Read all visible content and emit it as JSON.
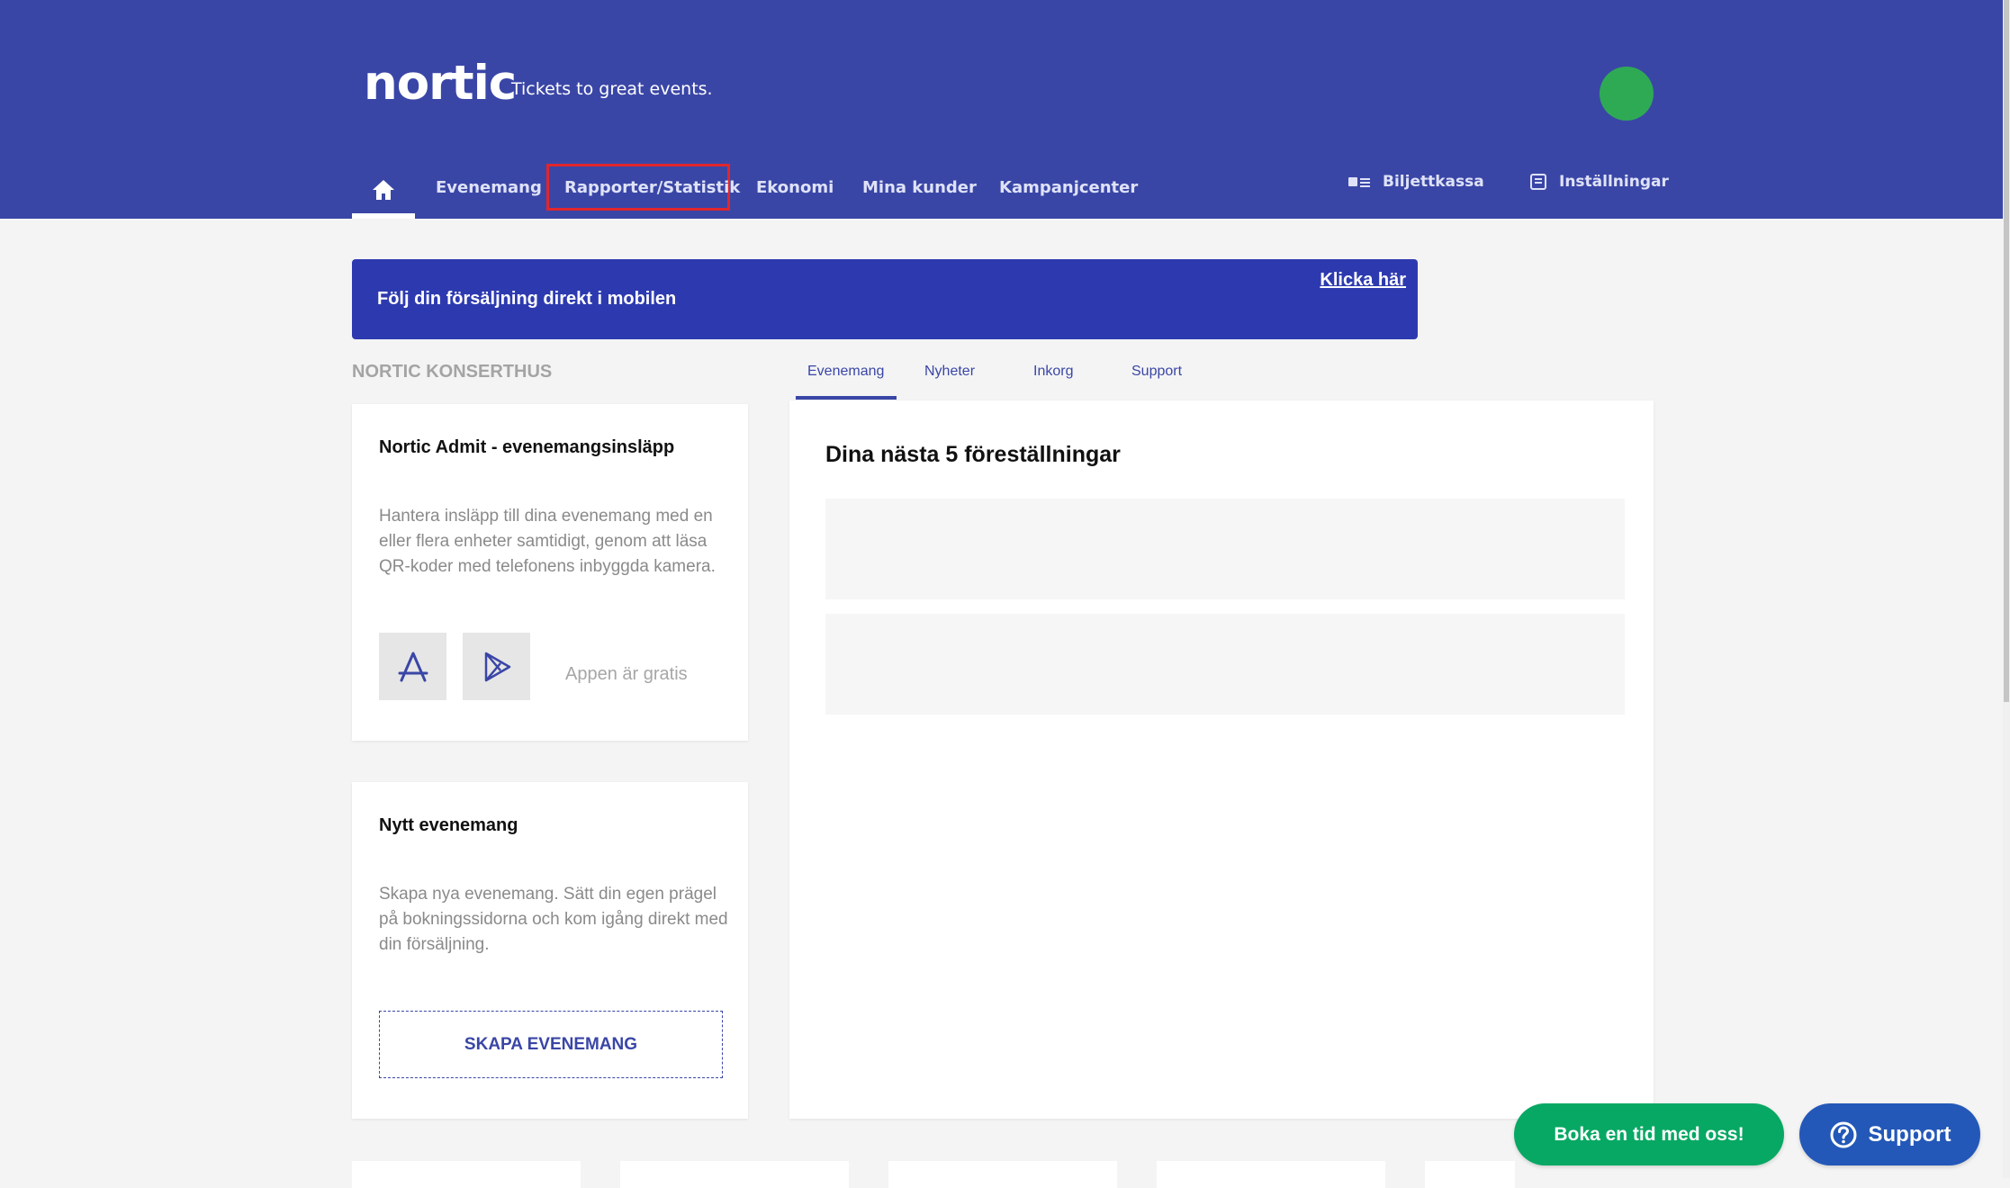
{
  "brand": {
    "logo": "nortic",
    "tagline": "Tickets to great events."
  },
  "nav": {
    "home_icon": "home-icon",
    "items": [
      "Evenemang",
      "Rapporter/Statistik",
      "Ekonomi",
      "Mina kunder",
      "Kampanjcenter"
    ],
    "right": [
      {
        "label": "Biljettkassa",
        "icon": "ticket-register-icon"
      },
      {
        "label": "Inställningar",
        "icon": "settings-icon"
      }
    ]
  },
  "banner": {
    "text": "Följ din försäljning direkt i mobilen",
    "link": "Klicka här"
  },
  "section_label": "NORTIC KONSERTHUS",
  "admit_card": {
    "title": "Nortic Admit - evenemangsinsläpp",
    "description": "Hantera insläpp till dina evenemang med en eller flera enheter samtidigt, genom att läsa QR-koder med telefonens inbyggda kamera.",
    "free_text": "Appen är gratis",
    "app_store_icon": "app-store-icon",
    "play_store_icon": "google-play-icon"
  },
  "new_event_card": {
    "title": "Nytt evenemang",
    "description": "Skapa nya evenemang. Sätt din egen prägel på bokningssidorna och kom igång direkt med din försäljning.",
    "button": "SKAPA EVENEMANG"
  },
  "tabs": [
    "Evenemang",
    "Nyheter",
    "Inkorg",
    "Support"
  ],
  "active_tab": "Evenemang",
  "main": {
    "title": "Dina nästa 5 föreställningar"
  },
  "floating": {
    "book": "Boka en tid med oss!",
    "support": "Support",
    "support_icon": "question-icon"
  },
  "colors": {
    "primary": "#3a46a6",
    "banner": "#2d3aaf",
    "green": "#07a863",
    "support_blue": "#2358b8",
    "avatar": "#2eaa55",
    "highlight": "#e0262c"
  }
}
